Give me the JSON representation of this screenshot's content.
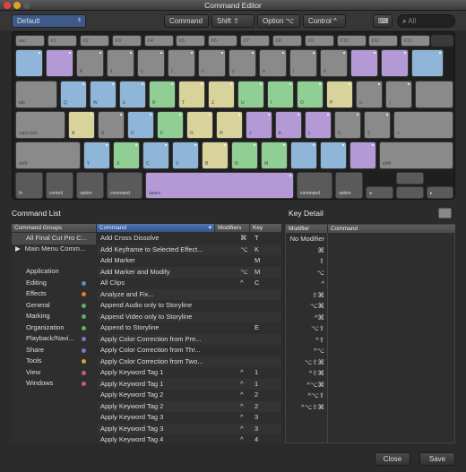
{
  "window": {
    "title": "Command Editor"
  },
  "toolbar": {
    "preset": "Default",
    "mod_command": "Command",
    "mod_shift": "Shift ⇧",
    "mod_option": "Option ⌥",
    "mod_control": "Control ^",
    "search_placeholder": "All"
  },
  "keyboard": {
    "row1": [
      "esc",
      "F1",
      "F2",
      "F3",
      "F4",
      "F5",
      "F6",
      "F7",
      "F8",
      "F9",
      "F10",
      "F11",
      "F12"
    ],
    "row2": [
      "",
      "",
      "ě",
      "š",
      "č",
      "ř",
      "ž",
      "ý",
      "á",
      "í",
      "é",
      "",
      "",
      ""
    ],
    "row3": [
      "tab",
      "Q",
      "W",
      "E",
      "R",
      "T",
      "Z",
      "U",
      "I",
      "O",
      "P",
      "ú",
      ")",
      ""
    ],
    "row4": [
      "caps lock",
      "A",
      "S",
      "D",
      "F",
      "G",
      "H",
      "J",
      "K",
      "L",
      "ů",
      "§",
      "↵"
    ],
    "row5": [
      "shift",
      "Y",
      "X",
      "C",
      "V",
      "B",
      "N",
      "M",
      "",
      "",
      "",
      "shift"
    ],
    "row6": [
      "fn",
      "control",
      "option",
      "command",
      "space",
      "command",
      "option",
      "◂",
      "▴▾",
      "▸"
    ]
  },
  "command_list": {
    "title": "Command List",
    "groups_header": "Command Groups",
    "command_header": "Command",
    "modifiers_header": "Modifiers",
    "key_header": "Key",
    "top_groups": [
      {
        "label": "All Final Cut Pro C..."
      },
      {
        "label": "Main Menu Comm..."
      }
    ],
    "groups": [
      {
        "label": "Application",
        "color": ""
      },
      {
        "label": "Editing",
        "color": "#5a8fd0"
      },
      {
        "label": "Effects",
        "color": "#e07a3a"
      },
      {
        "label": "General",
        "color": "#5bb06a"
      },
      {
        "label": "Marking",
        "color": "#5bb06a"
      },
      {
        "label": "Organization",
        "color": "#5bb06a"
      },
      {
        "label": "Playback/Navi...",
        "color": "#8b6fc0"
      },
      {
        "label": "Share",
        "color": "#8b6fc0"
      },
      {
        "label": "Tools",
        "color": "#d0a040"
      },
      {
        "label": "View",
        "color": "#c05a8a"
      },
      {
        "label": "Windows",
        "color": "#c05a8a"
      }
    ],
    "commands": [
      {
        "name": "Add Cross Dissolve",
        "mod": "⌘",
        "key": "T"
      },
      {
        "name": "Add Keyframe to Selected Effect...",
        "mod": "⌥",
        "key": "K"
      },
      {
        "name": "Add Marker",
        "mod": "",
        "key": "M"
      },
      {
        "name": "Add Marker and Modify",
        "mod": "⌥",
        "key": "M"
      },
      {
        "name": "All Clips",
        "mod": "^",
        "key": "C"
      },
      {
        "name": "Analyze and Fix...",
        "mod": "",
        "key": ""
      },
      {
        "name": "Append Audio only to Storyline",
        "mod": "",
        "key": ""
      },
      {
        "name": "Append Video only to Storyline",
        "mod": "",
        "key": ""
      },
      {
        "name": "Append to Storyline",
        "mod": "",
        "key": "E"
      },
      {
        "name": "Apply Color Correction from Pre...",
        "mod": "",
        "key": ""
      },
      {
        "name": "Apply Color Correction from Thr...",
        "mod": "",
        "key": ""
      },
      {
        "name": "Apply Color Correction from Two...",
        "mod": "",
        "key": ""
      },
      {
        "name": "Apply Keyword Tag 1",
        "mod": "^",
        "key": "1"
      },
      {
        "name": "Apply Keyword Tag 1",
        "mod": "^",
        "key": "1"
      },
      {
        "name": "Apply Keyword Tag 2",
        "mod": "^",
        "key": "2"
      },
      {
        "name": "Apply Keyword Tag 2",
        "mod": "^",
        "key": "2"
      },
      {
        "name": "Apply Keyword Tag 3",
        "mod": "^",
        "key": "3"
      },
      {
        "name": "Apply Keyword Tag 3",
        "mod": "^",
        "key": "3"
      },
      {
        "name": "Apply Keyword Tag 4",
        "mod": "^",
        "key": "4"
      }
    ]
  },
  "key_detail": {
    "title": "Key Detail",
    "modifier_header": "Modifier",
    "command_header": "Command",
    "rows": [
      "No Modifier",
      "⌘",
      "⇧",
      "⌥",
      "^",
      "⇧⌘",
      "⌥⌘",
      "^⌘",
      "⌥⇧",
      "^⇧",
      "^⌥",
      "⌥⇧⌘",
      "^⇧⌘",
      "^⌥⌘",
      "^⌥⇧",
      "^⌥⇧⌘"
    ]
  },
  "footer": {
    "close": "Close",
    "save": "Save"
  }
}
